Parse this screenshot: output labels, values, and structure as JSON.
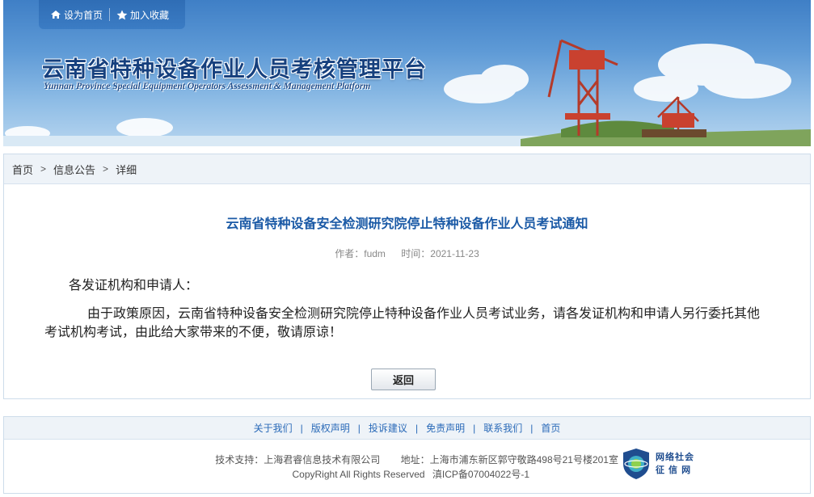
{
  "header": {
    "set_home_label": "设为首页",
    "add_favorite_label": "加入收藏",
    "site_title": "云南省特种设备作业人员考核管理平台",
    "site_subtitle": "Yunnan Province Special Equipment Operators Assessment & Management Platform"
  },
  "breadcrumb": {
    "home": "首页",
    "sep1": ">",
    "section": "信息公告",
    "sep2": ">",
    "current": "详细"
  },
  "article": {
    "title": "云南省特种设备安全检测研究院停止特种设备作业人员考试通知",
    "author": "作者：fudm",
    "time": "时间：2021-11-23",
    "salutation": "各发证机构和申请人：",
    "body": "由于政策原因，云南省特种设备安全检测研究院停止特种设备作业人员考试业务，请各发证机构和申请人另行委托其他考试机构考试，由此给大家带来的不便，敬请原谅！",
    "back_label": "返回"
  },
  "footer": {
    "links": [
      "关于我们",
      "版权声明",
      "投诉建议",
      "免责声明",
      "联系我们",
      "首页"
    ],
    "pipe": "|",
    "tech_support": "技术支持：上海君睿信息技术有限公司",
    "address": "地址：上海市浦东新区郭守敬路498号21号楼201室",
    "copyright": "CopyRight All Rights Reserved",
    "icp": "滇ICP备07004022号-1",
    "credit_line1": "网络社会",
    "credit_line2": "征 信 网"
  },
  "colors": {
    "title_blue": "#1b5aa6",
    "link_blue": "#2a6ab8",
    "banner_top": "#3f7fc6"
  }
}
